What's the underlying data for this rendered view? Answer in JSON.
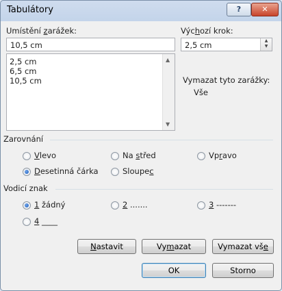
{
  "window": {
    "title": "Tabulátory",
    "help_label": "?",
    "close_label": "✕"
  },
  "tab_stop": {
    "label_prefix": "Umístění ",
    "label_accel": "z",
    "label_suffix": "arážek:",
    "input_value": "10,5 cm",
    "list": [
      "2,5 cm",
      "6,5 cm",
      "10,5 cm"
    ]
  },
  "default_step": {
    "label_prefix": "Výc",
    "label_accel": "h",
    "label_suffix": "ozí krok:",
    "value": "2,5 cm"
  },
  "clear": {
    "label": "Vymazat tyto zarážky:",
    "value": "Vše"
  },
  "alignment": {
    "title": "Zarovnání",
    "options": [
      {
        "prefix": "",
        "accel": "V",
        "suffix": "levo",
        "selected": false
      },
      {
        "prefix": "Na ",
        "accel": "s",
        "suffix": "třed",
        "selected": false
      },
      {
        "prefix": "Vp",
        "accel": "r",
        "suffix": "avo",
        "selected": false
      },
      {
        "prefix": "",
        "accel": "D",
        "suffix": "esetinná čárka",
        "selected": true
      },
      {
        "prefix": "Sloupe",
        "accel": "c",
        "suffix": "",
        "selected": false
      }
    ]
  },
  "leader": {
    "title": "Vodicí znak",
    "options": [
      {
        "accel": "1",
        "suffix": " žádný",
        "selected": true
      },
      {
        "accel": "2",
        "suffix": " .......",
        "selected": false
      },
      {
        "accel": "3",
        "suffix": " -------",
        "selected": false
      },
      {
        "accel": "4",
        "suffix": " ____",
        "selected": false
      }
    ]
  },
  "buttons": {
    "set": {
      "accel": "N",
      "suffix": "astavit"
    },
    "clear": {
      "prefix": "Vy",
      "accel": "m",
      "suffix": "azat"
    },
    "clear_all": {
      "prefix": "Vymazat vš",
      "accel": "e",
      "suffix": ""
    },
    "ok": "OK",
    "cancel": "Storno"
  }
}
